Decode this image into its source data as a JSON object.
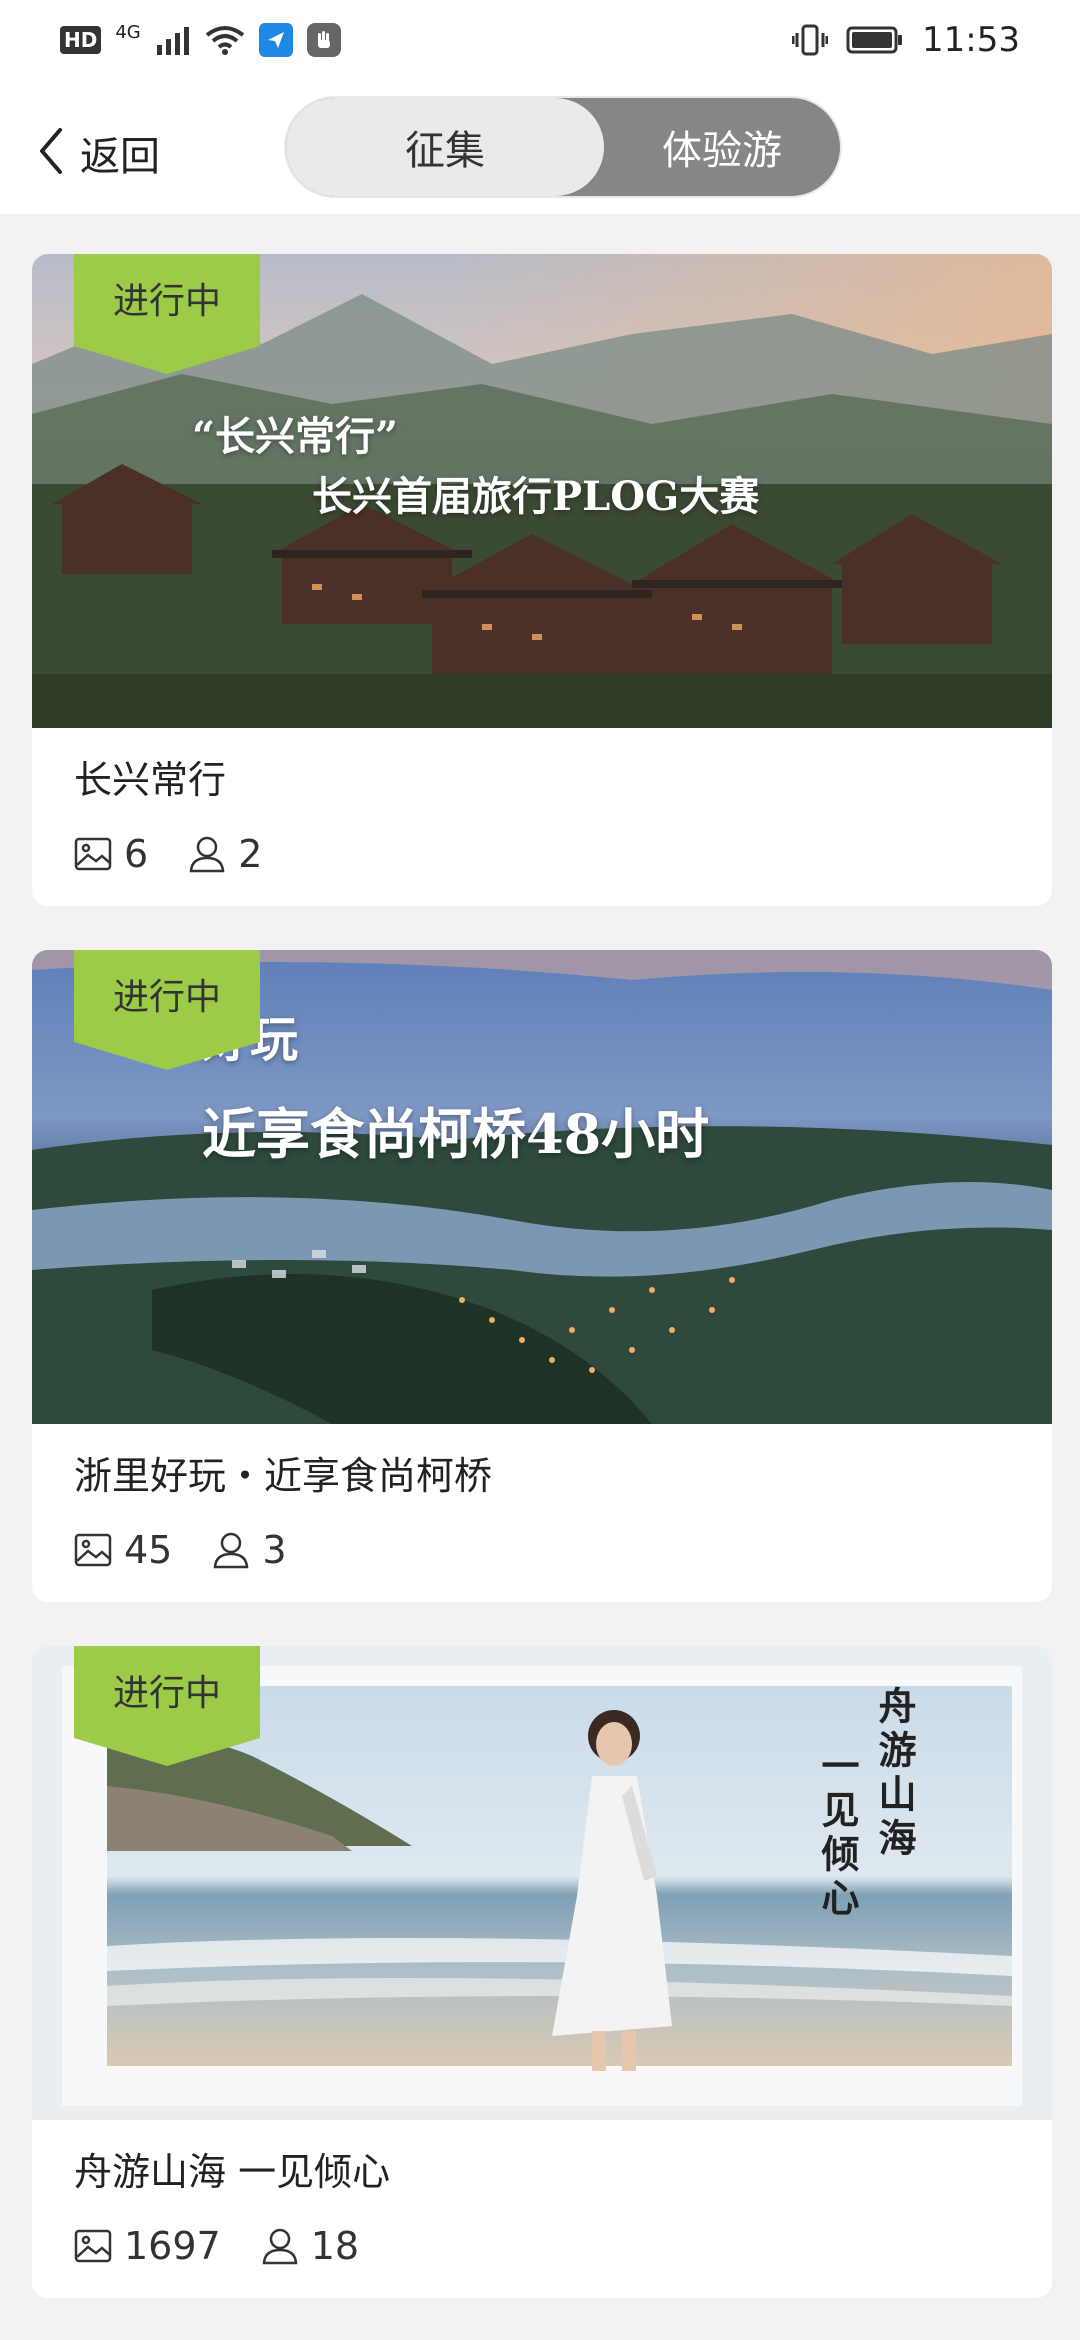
{
  "status_bar": {
    "hd": "HD",
    "network": "4G",
    "time": "11:53",
    "icons": [
      "signal-icon",
      "wifi-icon",
      "app-notification-icon",
      "hand-icon",
      "vibrate-icon",
      "battery-icon"
    ]
  },
  "header": {
    "back_label": "返回",
    "tabs": [
      {
        "label": "征集",
        "active": true
      },
      {
        "label": "体验游",
        "active": false
      }
    ]
  },
  "colors": {
    "badge": "#9ccb48",
    "segment_active": "#e9eaec",
    "segment_inactive": "#868686"
  },
  "cards": [
    {
      "status": "进行中",
      "overlay_line1": "“长兴常行”",
      "overlay_line2": "长兴首届旅行PLOG大赛",
      "title": "长兴常行",
      "photos": "6",
      "participants": "2"
    },
    {
      "status": "进行中",
      "overlay_line1": "好玩",
      "overlay_line2": "近享食尚柯桥48小时",
      "title": "浙里好玩・近享食尚柯桥",
      "photos": "45",
      "participants": "3"
    },
    {
      "status": "进行中",
      "overlay_line1": "舟游山海",
      "overlay_line2": "一见倾心",
      "title": "舟游山海 一见倾心",
      "photos": "1697",
      "participants": "18"
    }
  ]
}
